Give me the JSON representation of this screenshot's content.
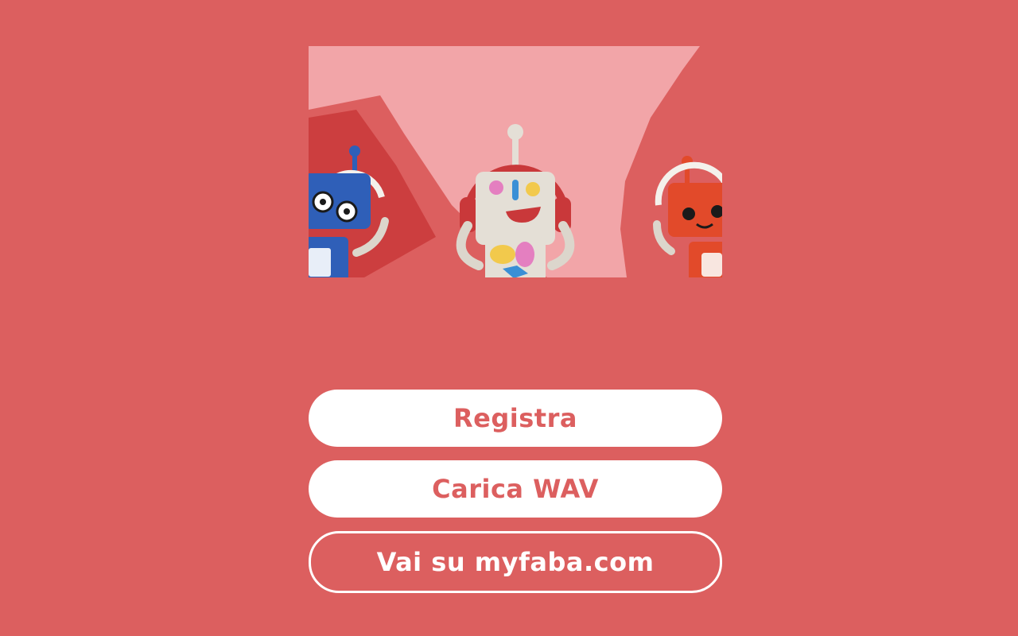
{
  "colors": {
    "background": "#dc5f5f",
    "button_fill": "#ffffff",
    "button_text": "#dc5f5f",
    "outline_text": "#ffffff",
    "hero_bg": "#f2a5a8",
    "robot_blue": "#2f5fb8",
    "robot_white": "#e4dfd6",
    "robot_red": "#e24a2a"
  },
  "hero": {
    "icons": [
      "blue-robot-icon",
      "white-robot-icon",
      "red-robot-icon"
    ]
  },
  "actions": {
    "record_label": "Registra",
    "upload_label": "Carica WAV",
    "website_label": "Vai su myfaba.com"
  }
}
